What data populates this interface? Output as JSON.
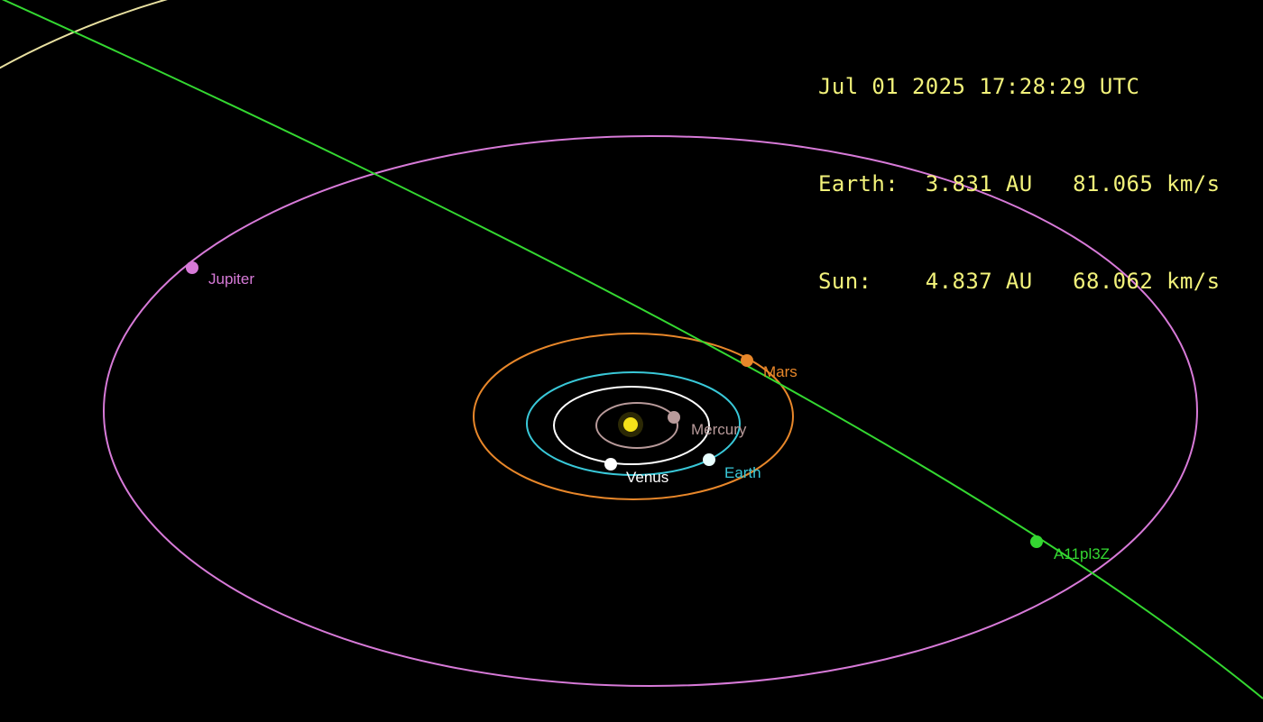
{
  "readout": {
    "timestamp": "Jul 01 2025 17:28:29 UTC",
    "earth_line": "Earth:  3.831 AU   81.065 km/s",
    "sun_line": "Sun:    4.837 AU   68.062 km/s"
  },
  "bodies": {
    "sun": {
      "color": "#f5e21a"
    },
    "mercury": {
      "label": "Mercury",
      "color": "#b89a9a"
    },
    "venus": {
      "label": "Venus",
      "color": "#ffffff"
    },
    "earth": {
      "label": "Earth",
      "color": "#39c8d8"
    },
    "mars": {
      "label": "Mars",
      "color": "#e8872a"
    },
    "jupiter": {
      "label": "Jupiter",
      "color": "#d77ad8"
    },
    "comet": {
      "label": "A11pl3Z",
      "color": "#34d831"
    }
  },
  "colors": {
    "background": "#000000",
    "readout_text": "#f2f27a",
    "outer_orbit": "#e8e0a0"
  }
}
